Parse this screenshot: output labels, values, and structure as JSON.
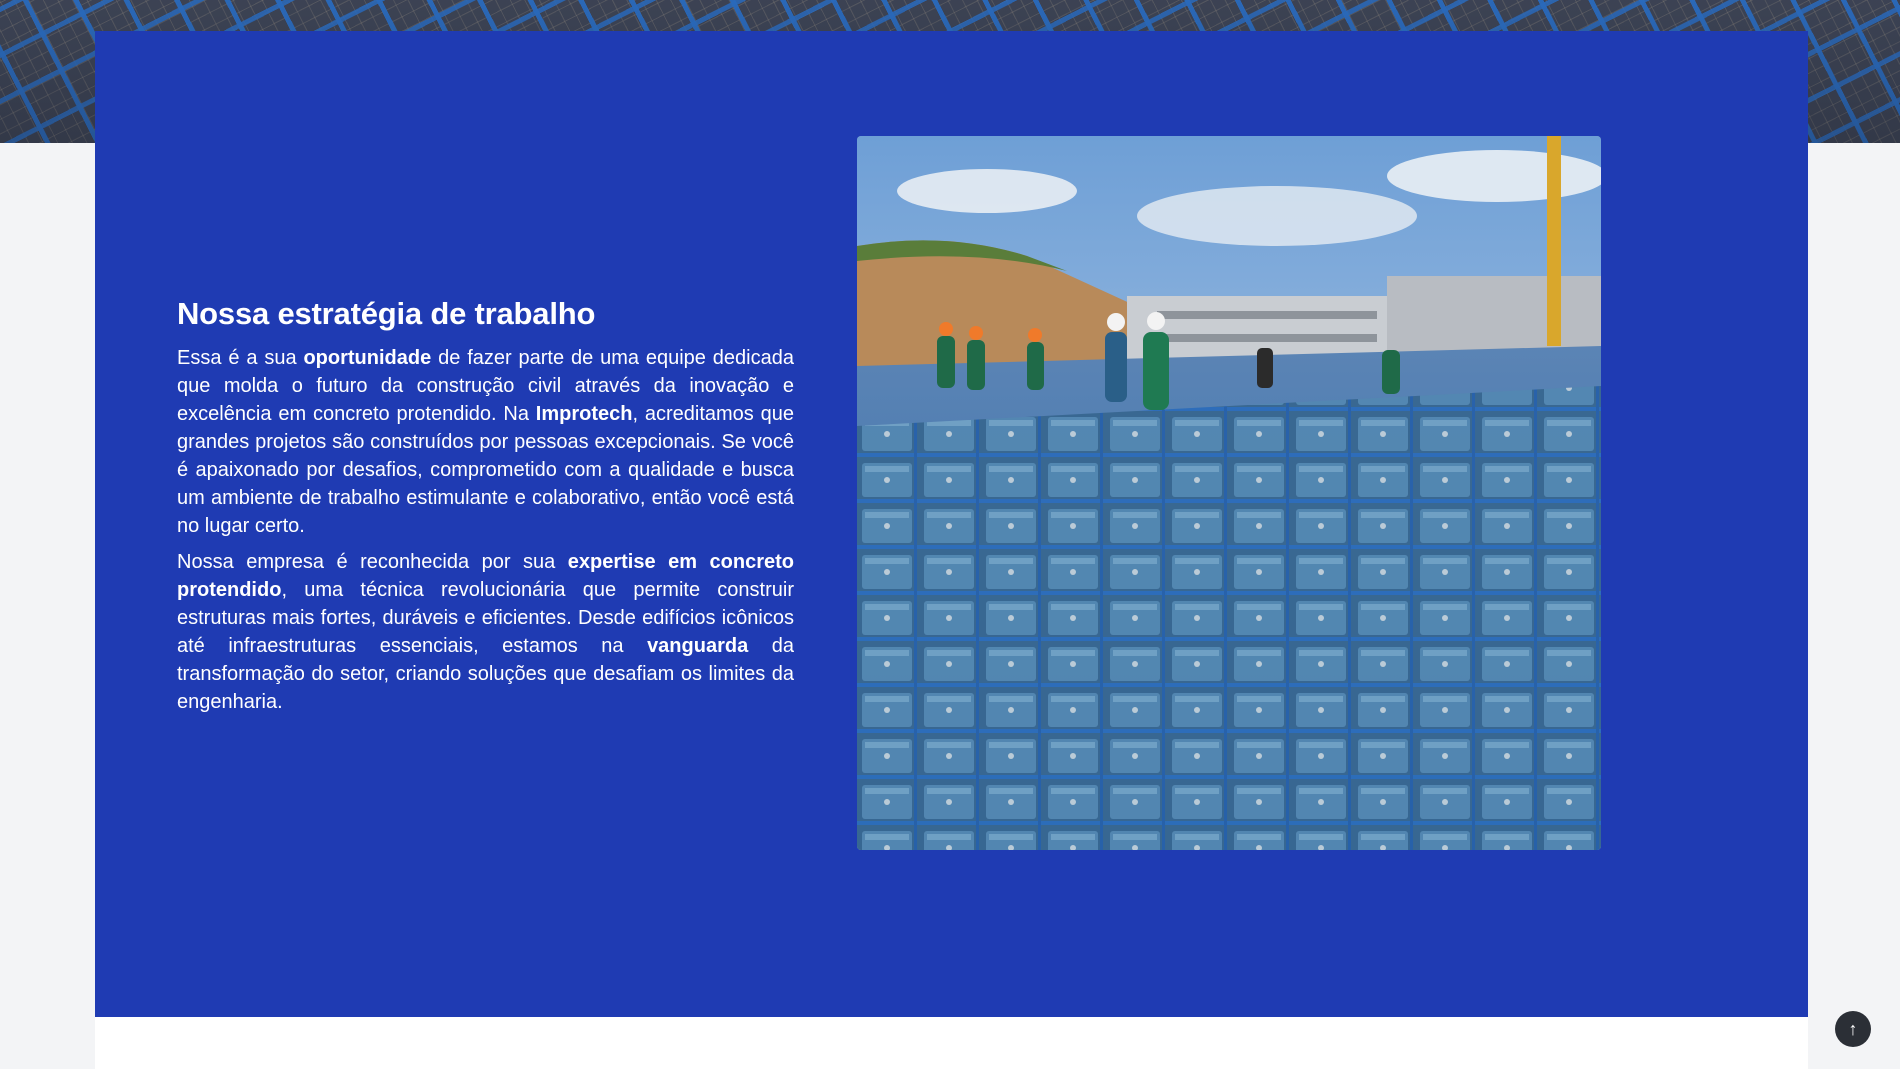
{
  "strategy": {
    "title": "Nossa estratégia de trabalho",
    "p1": [
      {
        "t": "Essa é a sua ",
        "b": false
      },
      {
        "t": "oportunidade",
        "b": true
      },
      {
        "t": " de fazer parte de uma equipe dedicada que molda o futuro da construção civil através da inovação e excelência em concreto protendido. Na ",
        "b": false
      },
      {
        "t": "Improtech",
        "b": true
      },
      {
        "t": ", acreditamos que grandes projetos são construídos por pessoas excepcionais. Se você é apaixonado por desafios, comprometido com a qualidade e busca um ambiente de trabalho estimulante e colaborativo, então você está no lugar certo.",
        "b": false
      }
    ],
    "p2": [
      {
        "t": "Nossa empresa é reconhecida por sua ",
        "b": false
      },
      {
        "t": "expertise em concreto protendido",
        "b": true
      },
      {
        "t": ", uma técnica revolucionária que permite construir estruturas mais fortes, duráveis e eficientes. Desde edifícios icônicos até infraestruturas essenciais, estamos na ",
        "b": false
      },
      {
        "t": "vanguarda",
        "b": true
      },
      {
        "t": " da transformação do setor, criando soluções que desafiam os limites da engenharia.",
        "b": false
      }
    ]
  },
  "back_to_top": {
    "icon": "arrow-up-icon",
    "glyph": "↑"
  },
  "colors": {
    "card_blue": "#1f3bb3",
    "form_blue": "#2f73c7",
    "page_bg": "#f3f4f6"
  }
}
